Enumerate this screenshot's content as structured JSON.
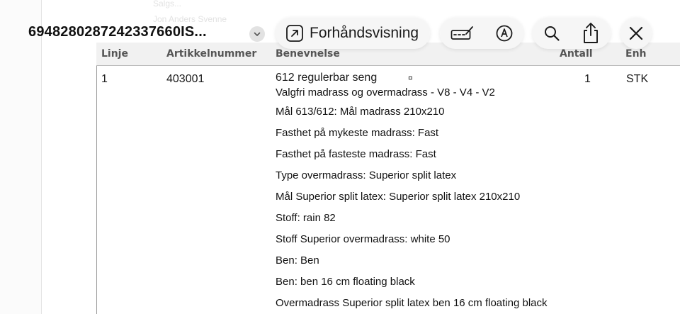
{
  "header": {
    "title": "6948280287242337660IS...",
    "preview_label": "Forhåndsvisning"
  },
  "background_text": {
    "line1": "Salgs...",
    "line2": "Jon Anders Svenne"
  },
  "table": {
    "columns": [
      "Linje",
      "Artikkelnummer",
      "Benevnelse",
      "Antall",
      "Enh"
    ],
    "row": {
      "line": "1",
      "article": "403001",
      "title": "612 regulerbar seng",
      "mark": "¤",
      "quantity": "1",
      "unit": "STK",
      "description": [
        "Valgfri madrass og overmadrass - V8 - V4 - V2",
        "Mål 613/612: Mål madrass 210x210",
        "Fasthet på mykeste madrass: Fast",
        "Fasthet på fasteste madrass: Fast",
        "Type overmadrass: Superior split latex",
        "Mål Superior split latex: Superior split latex 210x210",
        "Stoff: rain 82",
        "Stoff Superior overmadrass: white 50",
        "Ben: Ben",
        "Ben: ben 16 cm floating black",
        "Overmadrass Superior split latex ben 16 cm floating black"
      ]
    }
  },
  "icons": {
    "chevron": "chevron-down-icon",
    "open": "open-in-app-icon",
    "markup": "highlighter-icon",
    "pen": "pen-circle-icon",
    "search": "search-icon",
    "share": "share-icon",
    "close": "close-icon"
  }
}
